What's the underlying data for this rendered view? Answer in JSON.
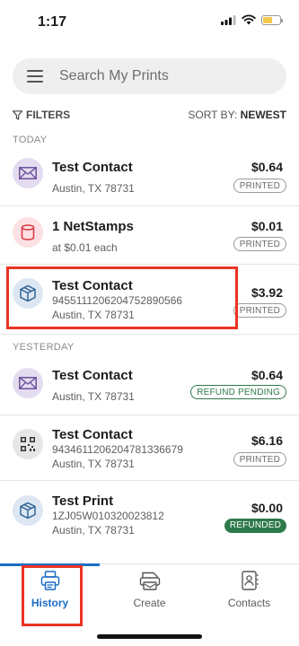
{
  "status_bar": {
    "time": "1:17"
  },
  "search": {
    "placeholder": "Search My Prints"
  },
  "filters": {
    "label": "FILTERS",
    "sort_label": "SORT BY:",
    "sort_value": "NEWEST"
  },
  "sections": {
    "today": "TODAY",
    "yesterday": "YESTERDAY"
  },
  "colors": {
    "accent": "#1a6dc5",
    "highlight": "#ea3323",
    "refund_green": "#2f7a4a"
  },
  "items": [
    {
      "icon": "envelope-icon",
      "title": "Test Contact",
      "line1": "Austin, TX 78731",
      "line2": "",
      "amount": "$0.64",
      "status": "PRINTED"
    },
    {
      "icon": "stamp-roll-icon",
      "title": "1 NetStamps",
      "line1": "at $0.01 each",
      "line2": "",
      "amount": "$0.01",
      "status": "PRINTED"
    },
    {
      "icon": "package-icon",
      "title": "Test Contact",
      "line1": "9455111206204752890566",
      "line2": "Austin, TX 78731",
      "amount": "$3.92",
      "status": "PRINTED"
    },
    {
      "icon": "envelope-icon",
      "title": "Test Contact",
      "line1": "Austin, TX 78731",
      "line2": "",
      "amount": "$0.64",
      "status": "REFUND PENDING"
    },
    {
      "icon": "qr-code-icon",
      "title": "Test Contact",
      "line1": "9434611206204781336679",
      "line2": "Austin, TX 78731",
      "amount": "$6.16",
      "status": "PRINTED"
    },
    {
      "icon": "package-icon",
      "title": "Test Print",
      "line1": "1ZJ05W010320023812",
      "line2": "Austin, TX 78731",
      "amount": "$0.00",
      "status": "REFUNDED"
    }
  ],
  "tabs": [
    {
      "label": "History",
      "icon": "printer-icon",
      "active": true
    },
    {
      "label": "Create",
      "icon": "create-label-icon",
      "active": false
    },
    {
      "label": "Contacts",
      "icon": "contacts-book-icon",
      "active": false
    }
  ]
}
